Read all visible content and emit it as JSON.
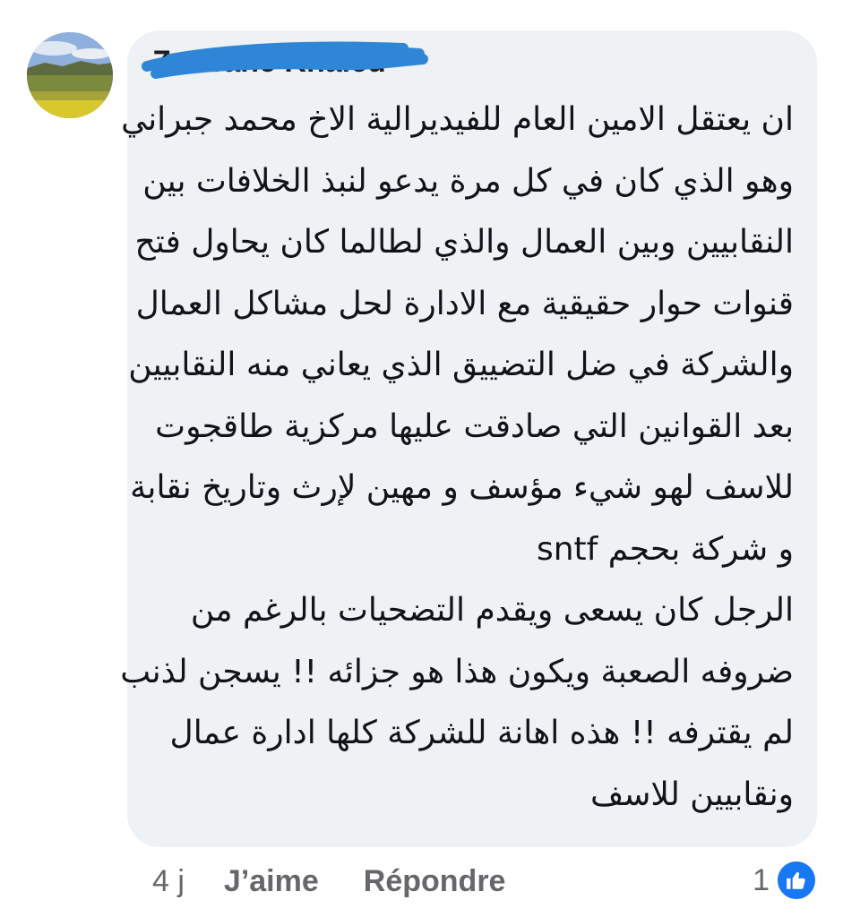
{
  "comment": {
    "author": "Zaabane Khaled",
    "lines": [
      "ان يعتقل الامين العام للفيديرالية الاخ محمد جبراني",
      "وهو الذي كان في كل مرة يدعو لنبذ الخلافات بين",
      "النقابيين وبين العمال والذي لطالما كان يحاول فتح",
      "قنوات حوار حقيقية مع الادارة لحل مشاكل العمال",
      "والشركة في ضل التضييق الذي يعاني منه النقابيين",
      "بعد القوانين التي صادقت عليها مركزية طاقجوت",
      "للاسف لهو شيء مؤسف و مهين لإرث وتاريخ نقابة",
      "و شركة بحجم sntf",
      "الرجل كان يسعى ويقدم التضحيات بالرغم من",
      "ضروفه الصعبة ويكون هذا هو جزائه !! يسجن لذنب",
      "لم يقترفه !! هذه اهانة للشركة كلها ادارة عمال",
      "ونقابيين للاسف"
    ]
  },
  "actions": {
    "time": "4 j",
    "like_label": "J’aime",
    "reply_label": "Répondre"
  },
  "reactions": {
    "count": "1",
    "icon": "thumbs-up-icon",
    "badge_color": "#1877f2"
  },
  "colors": {
    "bubble": "#eff2f5",
    "scribble": "#2f86d6",
    "meta_text": "#65676b"
  }
}
